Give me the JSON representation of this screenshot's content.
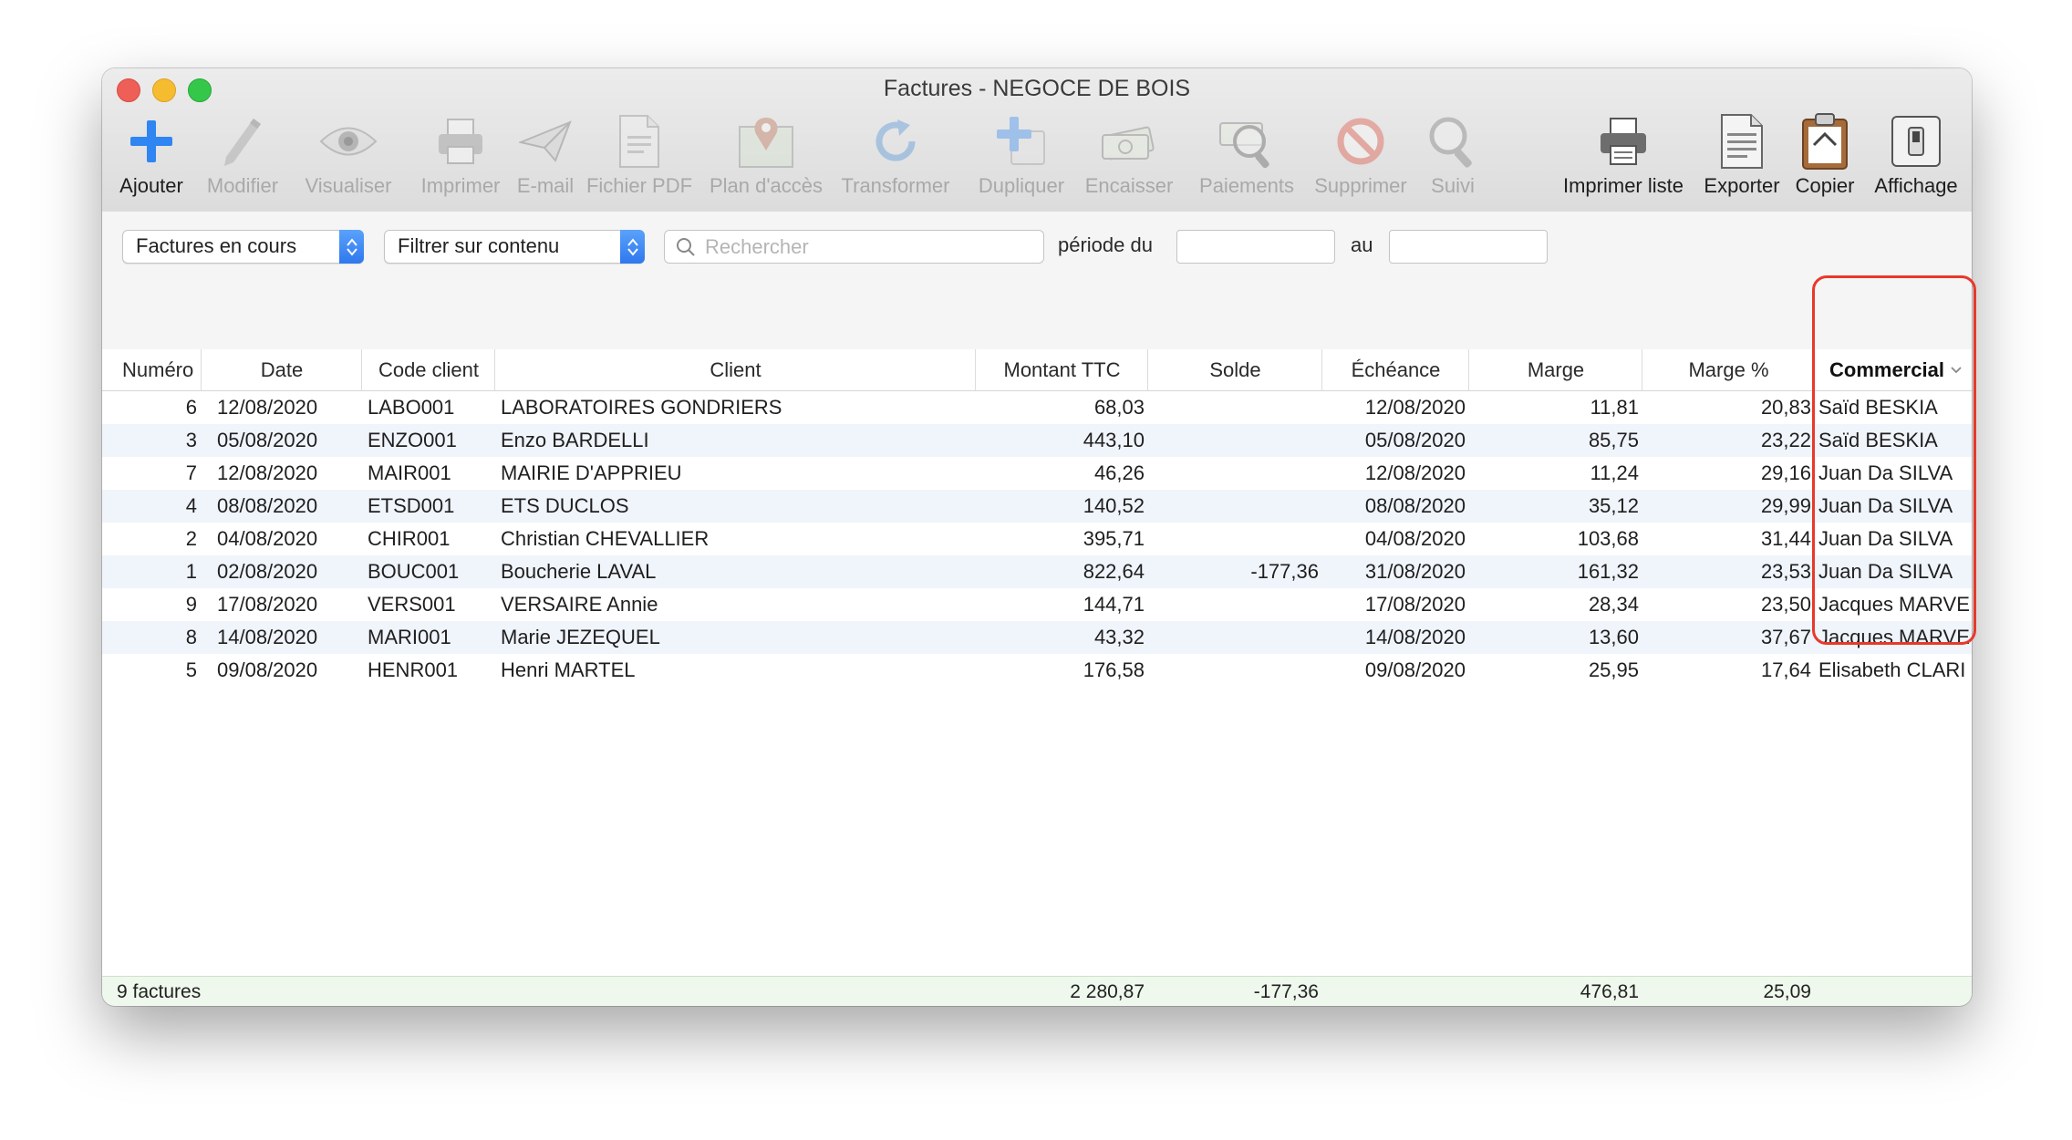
{
  "window": {
    "title": "Factures - NEGOCE DE BOIS"
  },
  "toolbar": {
    "items": [
      {
        "label": "Ajouter",
        "icon": "plus-icon",
        "enabled": true
      },
      {
        "label": "Modifier",
        "icon": "pencil-icon",
        "enabled": false
      },
      {
        "label": "Visualiser",
        "icon": "eye-icon",
        "enabled": false
      },
      {
        "label": "Imprimer",
        "icon": "printer-icon",
        "enabled": false
      },
      {
        "label": "E-mail",
        "icon": "paper-plane-icon",
        "enabled": false
      },
      {
        "label": "Fichier PDF",
        "icon": "pdf-document-icon",
        "enabled": false
      },
      {
        "label": "Plan d'accès",
        "icon": "map-pin-icon",
        "enabled": false
      },
      {
        "label": "Transformer",
        "icon": "refresh-icon",
        "enabled": false
      },
      {
        "label": "Dupliquer",
        "icon": "duplicate-icon",
        "enabled": false
      },
      {
        "label": "Encaisser",
        "icon": "cash-icon",
        "enabled": false
      },
      {
        "label": "Paiements",
        "icon": "payments-magnifier-icon",
        "enabled": false
      },
      {
        "label": "Supprimer",
        "icon": "no-entry-icon",
        "enabled": false
      },
      {
        "label": "Suivi",
        "icon": "magnifier-icon",
        "enabled": false
      },
      {
        "label": "Imprimer liste",
        "icon": "printer-list-icon",
        "enabled": true
      },
      {
        "label": "Exporter",
        "icon": "export-document-icon",
        "enabled": true
      },
      {
        "label": "Copier",
        "icon": "clipboard-icon",
        "enabled": true
      },
      {
        "label": "Affichage",
        "icon": "display-switch-icon",
        "enabled": true
      }
    ]
  },
  "filters": {
    "status_select": "Factures en cours",
    "content_filter_select": "Filtrer sur contenu",
    "search_placeholder": "Rechercher",
    "period_from_label": "période du",
    "period_to_label": "au",
    "period_from_value": "",
    "period_to_value": ""
  },
  "table": {
    "columns": [
      "Numéro",
      "Date",
      "Code client",
      "Client",
      "Montant TTC",
      "Solde",
      "Échéance",
      "Marge",
      "Marge %",
      "Commercial"
    ],
    "sorted_column": "Commercial",
    "rows": [
      [
        "6",
        "12/08/2020",
        "LABO001",
        "LABORATOIRES GONDRIERS",
        "68,03",
        "",
        "12/08/2020",
        "11,81",
        "20,83",
        "Saïd BESKIA"
      ],
      [
        "3",
        "05/08/2020",
        "ENZO001",
        "Enzo BARDELLI",
        "443,10",
        "",
        "05/08/2020",
        "85,75",
        "23,22",
        "Saïd BESKIA"
      ],
      [
        "7",
        "12/08/2020",
        "MAIR001",
        "MAIRIE D'APPRIEU",
        "46,26",
        "",
        "12/08/2020",
        "11,24",
        "29,16",
        "Juan Da SILVA"
      ],
      [
        "4",
        "08/08/2020",
        "ETSD001",
        "ETS DUCLOS",
        "140,52",
        "",
        "08/08/2020",
        "35,12",
        "29,99",
        "Juan Da SILVA"
      ],
      [
        "2",
        "04/08/2020",
        "CHIR001",
        "Christian CHEVALLIER",
        "395,71",
        "",
        "04/08/2020",
        "103,68",
        "31,44",
        "Juan Da SILVA"
      ],
      [
        "1",
        "02/08/2020",
        "BOUC001",
        "Boucherie LAVAL",
        "822,64",
        "-177,36",
        "31/08/2020",
        "161,32",
        "23,53",
        "Juan Da SILVA"
      ],
      [
        "9",
        "17/08/2020",
        "VERS001",
        "VERSAIRE Annie",
        "144,71",
        "",
        "17/08/2020",
        "28,34",
        "23,50",
        "Jacques MARVE"
      ],
      [
        "8",
        "14/08/2020",
        "MARI001",
        "Marie JEZEQUEL",
        "43,32",
        "",
        "14/08/2020",
        "13,60",
        "37,67",
        "Jacques MARVE"
      ],
      [
        "5",
        "09/08/2020",
        "HENR001",
        "Henri MARTEL",
        "176,58",
        "",
        "09/08/2020",
        "25,95",
        "17,64",
        "Elisabeth CLARI"
      ]
    ]
  },
  "footer": {
    "count": "9 factures",
    "total_ttc": "2 280,87",
    "total_solde": "-177,36",
    "total_marge": "476,81",
    "marge_percent": "25,09"
  },
  "colors": {
    "accent_blue": "#2f78ee",
    "highlight_red": "#e8392b",
    "row_alt": "#f0f4fb",
    "footer_bg": "#eef8ec"
  }
}
